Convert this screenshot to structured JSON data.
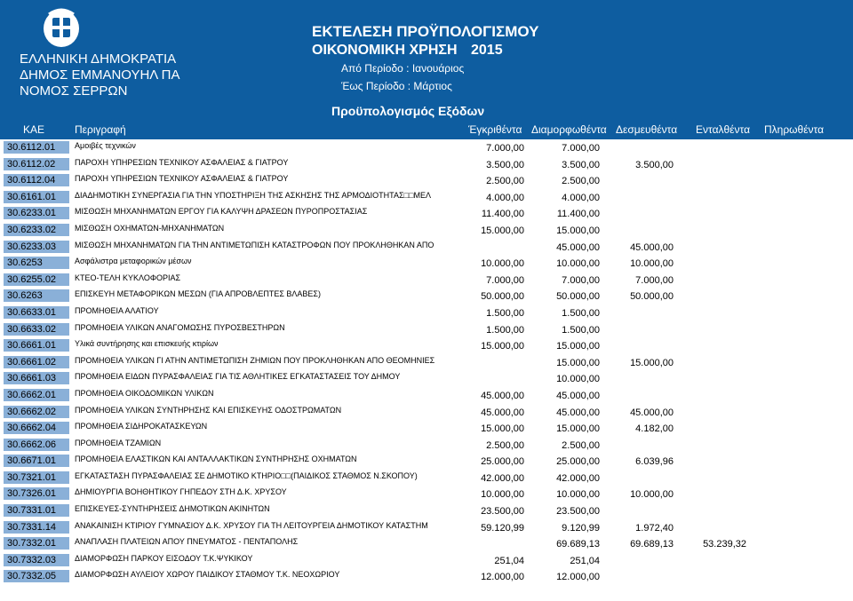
{
  "header": {
    "org_line1": "ΕΛΛΗΝΙΚΗ ΔΗΜΟΚΡΑΤΙΑ",
    "org_line2": "ΔΗΜΟΣ ΕΜΜΑΝΟΥΗΛ ΠΑ",
    "org_line3": "ΝΟΜΟΣ ΣΕΡΡΩΝ",
    "title": "ΕΚΤΕΛΕΣΗ ΠΡΟΫΠΟΛΟΓΙΣΜΟΥ",
    "fiscal_label": "ΟΙΚΟΝΟΜΙΚΗ ΧΡΗΣΗ",
    "fiscal_year": "2015",
    "period_from": "Από Περίοδο :  Ιανουάριος",
    "period_to": "Έως Περίοδο :  Μάρτιος",
    "subtitle": "Προϋπολογισμός Εξόδων"
  },
  "columns": {
    "kae": "ΚΑΕ",
    "description": "Περιγραφή",
    "approved": "Έγκριθέντα",
    "formed": "Διαμορφωθέντα",
    "committed": "Δεσμευθέντα",
    "ordered": "Ενταλθέντα",
    "paid": "Πληρωθέντα"
  },
  "rows": [
    {
      "kae": "30.6112.01",
      "desc": "Αμοιβές τεχνικών",
      "approved": "7.000,00",
      "formed": "7.000,00",
      "committed": "",
      "ordered": "",
      "paid": ""
    },
    {
      "kae": "30.6112.02",
      "desc": "ΠΑΡΟΧΗ ΥΠΗΡΕΣΙΩΝ ΤΕΧΝΙΚΟΥ ΑΣΦΑΛΕΙΑΣ & ΓΙΑΤΡΟΥ",
      "approved": "3.500,00",
      "formed": "3.500,00",
      "committed": "3.500,00",
      "ordered": "",
      "paid": ""
    },
    {
      "kae": "30.6112.04",
      "desc": "ΠΑΡΟΧΗ ΥΠΗΡΕΣΙΩΝ ΤΕΧΝΙΚΟΥ ΑΣΦΑΛΕΙΑΣ & ΓΙΑΤΡΟΥ",
      "approved": "2.500,00",
      "formed": "2.500,00",
      "committed": "",
      "ordered": "",
      "paid": ""
    },
    {
      "kae": "30.6161.01",
      "desc": "ΔΙΑΔΗΜΟΤΙΚΗ ΣΥΝΕΡΓΑΣΙΑ ΓΙΑ ΤΗΝ ΥΠΟΣΤΗΡΙΞΗ ΤΗΣ ΑΣΚΗΣΗΣ ΤΗΣ ΑΡΜΟΔΙΟΤΗΤΑΣ□□ΜΕΛ",
      "approved": "4.000,00",
      "formed": "4.000,00",
      "committed": "",
      "ordered": "",
      "paid": ""
    },
    {
      "kae": "30.6233.01",
      "desc": "ΜΙΣΘΩΣΗ ΜΗΧΑΝΗΜΑΤΩΝ ΕΡΓΟΥ ΓΙΑ ΚΑΛΥΨΗ ΔΡΑΣΕΩΝ ΠΥΡΟΠΡΟΣΤΑΣΙΑΣ",
      "approved": "11.400,00",
      "formed": "11.400,00",
      "committed": "",
      "ordered": "",
      "paid": ""
    },
    {
      "kae": "30.6233.02",
      "desc": "ΜΙΣΘΩΣΗ ΟΧΗΜΑΤΩΝ-ΜΗΧΑΝΗΜΑΤΩΝ",
      "approved": "15.000,00",
      "formed": "15.000,00",
      "committed": "",
      "ordered": "",
      "paid": ""
    },
    {
      "kae": "30.6233.03",
      "desc": "ΜΙΣΘΩΣΗ ΜΗΧΑΝΗΜΑΤΩΝ ΓΙΑ ΤΗΝ ΑΝΤΙΜΕΤΩΠΙΣΗ ΚΑΤΑΣΤΡΟΦΩΝ ΠΟΥ ΠΡΟΚΛΗΘΗΚΑΝ ΑΠΟ",
      "approved": "",
      "formed": "45.000,00",
      "committed": "45.000,00",
      "ordered": "",
      "paid": ""
    },
    {
      "kae": "30.6253",
      "desc": "Ασφάλιστρα μεταφορικών μέσων",
      "approved": "10.000,00",
      "formed": "10.000,00",
      "committed": "10.000,00",
      "ordered": "",
      "paid": ""
    },
    {
      "kae": "30.6255.02",
      "desc": "ΚΤΕΟ-ΤΕΛΗ ΚΥΚΛΟΦΟΡΙΑΣ",
      "approved": "7.000,00",
      "formed": "7.000,00",
      "committed": "7.000,00",
      "ordered": "",
      "paid": ""
    },
    {
      "kae": "30.6263",
      "desc": "ΕΠΙΣΚΕΥΗ ΜΕΤΑΦΟΡΙΚΩΝ ΜΕΣΩΝ (ΓΙΑ ΑΠΡΟΒΛΕΠΤΕΣ ΒΛΑΒΕΣ)",
      "approved": "50.000,00",
      "formed": "50.000,00",
      "committed": "50.000,00",
      "ordered": "",
      "paid": ""
    },
    {
      "kae": "30.6633.01",
      "desc": "ΠΡΟΜΗΘΕΙΑ ΑΛΑΤΙΟΥ",
      "approved": "1.500,00",
      "formed": "1.500,00",
      "committed": "",
      "ordered": "",
      "paid": ""
    },
    {
      "kae": "30.6633.02",
      "desc": "ΠΡΟΜΗΘΕΙΑ ΥΛΙΚΩΝ ΑΝΑΓΟΜΩΣΗΣ ΠΥΡΟΣΒΕΣΤΗΡΩΝ",
      "approved": "1.500,00",
      "formed": "1.500,00",
      "committed": "",
      "ordered": "",
      "paid": ""
    },
    {
      "kae": "30.6661.01",
      "desc": "Υλικά συντήρησης και επισκευής κτιρίων",
      "approved": "15.000,00",
      "formed": "15.000,00",
      "committed": "",
      "ordered": "",
      "paid": ""
    },
    {
      "kae": "30.6661.02",
      "desc": "ΠΡΟΜΗΘΕΙΑ ΥΛΙΚΩΝ ΓΙ ΑΤΗΝ ΑΝΤΙΜΕΤΩΠΙΣΗ ΖΗΜΙΩΝ ΠΟΥ ΠΡΟΚΛΗΘΗΚΑΝ ΑΠΟ ΘΕΟΜΗΝΙΕΣ",
      "approved": "",
      "formed": "15.000,00",
      "committed": "15.000,00",
      "ordered": "",
      "paid": ""
    },
    {
      "kae": "30.6661.03",
      "desc": "ΠΡΟΜΗΘΕΙΑ ΕΙΔΩΝ ΠΥΡΑΣΦΑΛΕΙΑΣ ΓΙΑ ΤΙΣ ΑΘΛΗΤΙΚΕΣ ΕΓΚΑΤΑΣΤΑΣΕΙΣ ΤΟΥ ΔΗΜΟΥ",
      "approved": "",
      "formed": "10.000,00",
      "committed": "",
      "ordered": "",
      "paid": ""
    },
    {
      "kae": "30.6662.01",
      "desc": "ΠΡΟΜΗΘΕΙΑ ΟΙΚΟΔΟΜΙΚΩΝ ΥΛΙΚΩΝ",
      "approved": "45.000,00",
      "formed": "45.000,00",
      "committed": "",
      "ordered": "",
      "paid": ""
    },
    {
      "kae": "30.6662.02",
      "desc": "ΠΡΟΜΗΘΕΙΑ ΥΛΙΚΩΝ ΣΥΝΤΗΡΗΣΗΣ ΚΑΙ ΕΠΙΣΚΕΥΗΣ ΟΔΟΣΤΡΩΜΑΤΩΝ",
      "approved": "45.000,00",
      "formed": "45.000,00",
      "committed": "45.000,00",
      "ordered": "",
      "paid": ""
    },
    {
      "kae": "30.6662.04",
      "desc": "ΠΡΟΜΗΘΕΙΑ ΣΙΔΗΡΟΚΑΤΑΣΚΕΥΩΝ",
      "approved": "15.000,00",
      "formed": "15.000,00",
      "committed": "4.182,00",
      "ordered": "",
      "paid": ""
    },
    {
      "kae": "30.6662.06",
      "desc": "ΠΡΟΜΗΘΕΙΑ ΤΖΑΜΙΩΝ",
      "approved": "2.500,00",
      "formed": "2.500,00",
      "committed": "",
      "ordered": "",
      "paid": ""
    },
    {
      "kae": "30.6671.01",
      "desc": "ΠΡΟΜΗΘΕΙΑ ΕΛΑΣΤΙΚΩΝ ΚΑΙ ΑΝΤΑΛΛΑΚΤΙΚΩΝ ΣΥΝΤΗΡΗΣΗΣ ΟΧΗΜΑΤΩΝ",
      "approved": "25.000,00",
      "formed": "25.000,00",
      "committed": "6.039,96",
      "ordered": "",
      "paid": ""
    },
    {
      "kae": "30.7321.01",
      "desc": "ΕΓΚΑΤΑΣΤΑΣΗ ΠΥΡΑΣΦΑΛΕΙΑΣ ΣΕ ΔΗΜΟΤΙΚΟ ΚΤΗΡΙΟ□□(ΠΑΙΔΙΚΟΣ ΣΤΑΘΜΟΣ Ν.ΣΚΟΠΟΥ)",
      "approved": "42.000,00",
      "formed": "42.000,00",
      "committed": "",
      "ordered": "",
      "paid": ""
    },
    {
      "kae": "30.7326.01",
      "desc": "ΔΗΜΙΟΥΡΓΙΑ ΒΟΗΘΗΤΙΚΟΥ ΓΗΠΕΔΟΥ ΣΤΗ Δ.Κ. ΧΡΥΣΟΥ",
      "approved": "10.000,00",
      "formed": "10.000,00",
      "committed": "10.000,00",
      "ordered": "",
      "paid": ""
    },
    {
      "kae": "30.7331.01",
      "desc": "ΕΠΙΣΚΕΥΕΣ-ΣΥΝΤΗΡΗΣΕΙΣ ΔΗΜΟΤΙΚΩΝ ΑΚΙΝΗΤΩΝ",
      "approved": "23.500,00",
      "formed": "23.500,00",
      "committed": "",
      "ordered": "",
      "paid": ""
    },
    {
      "kae": "30.7331.14",
      "desc": "ΑΝΑΚΑΙΝΙΣΗ ΚΤΙΡΙΟΥ ΓΥΜΝΑΣΙΟΥ Δ.Κ. ΧΡΥΣΟΥ ΓΙΑ ΤΗ ΛΕΙΤΟΥΡΓΕΙΑ ΔΗΜΟΤΙΚΟΥ ΚΑΤΑΣΤΗΜ",
      "approved": "59.120,99",
      "formed": "9.120,99",
      "committed": "1.972,40",
      "ordered": "",
      "paid": ""
    },
    {
      "kae": "30.7332.01",
      "desc": "ΑΝΑΠΛΑΣΗ ΠΛΑΤΕΙΩΝ ΑΠΟΥ ΠΝΕΥΜΑΤΟΣ - ΠΕΝΤΑΠΟΛΗΣ",
      "approved": "",
      "formed": "69.689,13",
      "committed": "69.689,13",
      "ordered": "53.239,32",
      "paid": ""
    },
    {
      "kae": "30.7332.03",
      "desc": "ΔΙΑΜΟΡΦΩΣΗ ΠΑΡΚΟΥ ΕΙΣΟΔΟΥ Τ.Κ.ΨΥΚΙΚΟΥ",
      "approved": "251,04",
      "formed": "251,04",
      "committed": "",
      "ordered": "",
      "paid": ""
    },
    {
      "kae": "30.7332.05",
      "desc": "ΔΙΑΜΟΡΦΩΣΗ ΑΥΛΕΙΟΥ ΧΩΡΟΥ ΠΑΙΔΙΚΟΥ ΣΤΑΘΜΟΥ Τ.Κ. ΝΕΟΧΩΡΙΟΥ",
      "approved": "12.000,00",
      "formed": "12.000,00",
      "committed": "",
      "ordered": "",
      "paid": ""
    }
  ]
}
